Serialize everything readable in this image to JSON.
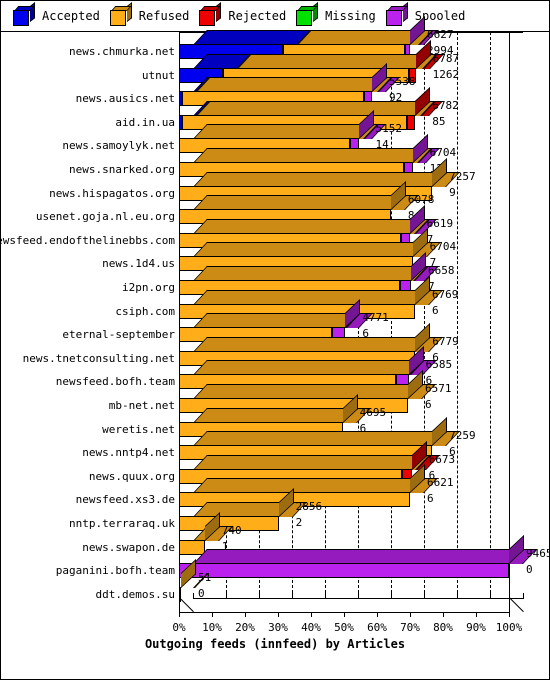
{
  "legend": {
    "items": [
      {
        "label": "Accepted",
        "color": "#0000ee",
        "icon": "cube-icon"
      },
      {
        "label": "Refused",
        "color": "#ffae1a",
        "icon": "cube-icon"
      },
      {
        "label": "Rejected",
        "color": "#ee0000",
        "icon": "cube-icon"
      },
      {
        "label": "Missing",
        "color": "#00e000",
        "icon": "cube-icon"
      },
      {
        "label": "Spooled",
        "color": "#bb22ee",
        "icon": "cube-icon"
      }
    ]
  },
  "chart_data": {
    "type": "bar",
    "orientation": "horizontal",
    "stacked": true,
    "title": "Outgoing feeds (innfeed) by Articles",
    "xlabel": "Outgoing feeds (innfeed) by Articles",
    "ylabel": "",
    "grid": true,
    "legend_position": "top",
    "xlim": [
      0,
      100
    ],
    "xunit": "%",
    "xticks": [
      0,
      10,
      20,
      30,
      40,
      50,
      60,
      70,
      80,
      90,
      100
    ],
    "xticklabels": [
      "0%",
      "10%",
      "20%",
      "30%",
      "40%",
      "50%",
      "60%",
      "70%",
      "80%",
      "90%",
      "100%"
    ],
    "series_names": [
      "Accepted",
      "Refused",
      "Rejected",
      "Missing",
      "Spooled"
    ],
    "categories": [
      "news.chmurka.net",
      "utnut",
      "news.ausics.net",
      "aid.in.ua",
      "news.samoylyk.net",
      "news.snarked.org",
      "news.hispagatos.org",
      "usenet.goja.nl.eu.org",
      "newsfeed.endofthelinebbs.com",
      "news.1d4.us",
      "i2pn.org",
      "csiph.com",
      "eternal-september",
      "news.tnetconsulting.net",
      "newsfeed.bofh.team",
      "mb-net.net",
      "weretis.net",
      "news.nntp4.net",
      "news.quux.org",
      "newsfeed.xs3.de",
      "nntp.terraraq.uk",
      "news.swapon.de",
      "paganini.bofh.team",
      "ddt.demos.su"
    ],
    "rows": [
      {
        "category": "news.chmurka.net",
        "total_label": "6627",
        "sub_label": "2994",
        "total_pct": 70.0,
        "segments": [
          {
            "name": "Accepted",
            "pct": 31.5
          },
          {
            "name": "Refused",
            "pct": 37.0
          },
          {
            "name": "Spooled",
            "pct": 1.5
          }
        ]
      },
      {
        "category": "utnut",
        "total_label": "6787",
        "sub_label": "1262",
        "total_pct": 71.7,
        "segments": [
          {
            "name": "Accepted",
            "pct": 13.3
          },
          {
            "name": "Refused",
            "pct": 56.4
          },
          {
            "name": "Rejected",
            "pct": 2.0
          }
        ]
      },
      {
        "category": "news.ausics.net",
        "total_label": "5538",
        "sub_label": "92",
        "total_pct": 58.5,
        "segments": [
          {
            "name": "Accepted",
            "pct": 1.0
          },
          {
            "name": "Refused",
            "pct": 55.0
          },
          {
            "name": "Spooled",
            "pct": 2.5
          }
        ]
      },
      {
        "category": "aid.in.ua",
        "total_label": "6782",
        "sub_label": "85",
        "total_pct": 71.6,
        "segments": [
          {
            "name": "Accepted",
            "pct": 0.9
          },
          {
            "name": "Refused",
            "pct": 68.2
          },
          {
            "name": "Rejected",
            "pct": 2.5
          }
        ]
      },
      {
        "category": "news.samoylyk.net",
        "total_label": "5152",
        "sub_label": "14",
        "total_pct": 54.4,
        "segments": [
          {
            "name": "Refused",
            "pct": 51.9
          },
          {
            "name": "Spooled",
            "pct": 2.5
          }
        ]
      },
      {
        "category": "news.snarked.org",
        "total_label": "6704",
        "sub_label": "12",
        "total_pct": 70.8,
        "segments": [
          {
            "name": "Refused",
            "pct": 68.3
          },
          {
            "name": "Spooled",
            "pct": 2.5
          }
        ]
      },
      {
        "category": "news.hispagatos.org",
        "total_label": "7257",
        "sub_label": "9",
        "total_pct": 76.7,
        "segments": [
          {
            "name": "Refused",
            "pct": 76.7
          }
        ]
      },
      {
        "category": "usenet.goja.nl.eu.org",
        "total_label": "6078",
        "sub_label": "8",
        "total_pct": 64.2,
        "segments": [
          {
            "name": "Refused",
            "pct": 64.2
          }
        ]
      },
      {
        "category": "newsfeed.endofthelinebbs.com",
        "total_label": "6619",
        "sub_label": "7",
        "total_pct": 69.9,
        "segments": [
          {
            "name": "Refused",
            "pct": 67.4
          },
          {
            "name": "Spooled",
            "pct": 2.5
          }
        ]
      },
      {
        "category": "news.1d4.us",
        "total_label": "6704",
        "sub_label": "7",
        "total_pct": 70.8,
        "segments": [
          {
            "name": "Refused",
            "pct": 70.8
          }
        ]
      },
      {
        "category": "i2pn.org",
        "total_label": "6658",
        "sub_label": "7",
        "total_pct": 70.3,
        "segments": [
          {
            "name": "Refused",
            "pct": 67.0
          },
          {
            "name": "Spooled",
            "pct": 3.3
          }
        ]
      },
      {
        "category": "csiph.com",
        "total_label": "6769",
        "sub_label": "6",
        "total_pct": 71.5,
        "segments": [
          {
            "name": "Refused",
            "pct": 71.5
          }
        ]
      },
      {
        "category": "eternal-september",
        "total_label": "4771",
        "sub_label": "6",
        "total_pct": 50.4,
        "segments": [
          {
            "name": "Refused",
            "pct": 46.5
          },
          {
            "name": "Spooled",
            "pct": 3.9
          }
        ]
      },
      {
        "category": "news.tnetconsulting.net",
        "total_label": "6779",
        "sub_label": "6",
        "total_pct": 71.6,
        "segments": [
          {
            "name": "Refused",
            "pct": 71.6
          }
        ]
      },
      {
        "category": "newsfeed.bofh.team",
        "total_label": "6585",
        "sub_label": "6",
        "total_pct": 69.6,
        "segments": [
          {
            "name": "Refused",
            "pct": 65.8
          },
          {
            "name": "Spooled",
            "pct": 3.8
          }
        ]
      },
      {
        "category": "mb-net.net",
        "total_label": "6571",
        "sub_label": "6",
        "total_pct": 69.4,
        "segments": [
          {
            "name": "Refused",
            "pct": 69.4
          }
        ]
      },
      {
        "category": "weretis.net",
        "total_label": "4695",
        "sub_label": "6",
        "total_pct": 49.6,
        "segments": [
          {
            "name": "Refused",
            "pct": 49.6
          }
        ]
      },
      {
        "category": "news.nntp4.net",
        "total_label": "7259",
        "sub_label": "6",
        "total_pct": 76.7,
        "segments": [
          {
            "name": "Refused",
            "pct": 76.7
          }
        ]
      },
      {
        "category": "news.quux.org",
        "total_label": "6673",
        "sub_label": "6",
        "total_pct": 70.5,
        "segments": [
          {
            "name": "Refused",
            "pct": 67.6
          },
          {
            "name": "Rejected",
            "pct": 2.9
          }
        ]
      },
      {
        "category": "newsfeed.xs3.de",
        "total_label": "6621",
        "sub_label": "6",
        "total_pct": 70.0,
        "segments": [
          {
            "name": "Refused",
            "pct": 70.0
          }
        ]
      },
      {
        "category": "nntp.terraraq.uk",
        "total_label": "2856",
        "sub_label": "2",
        "total_pct": 30.2,
        "segments": [
          {
            "name": "Refused",
            "pct": 30.2
          }
        ]
      },
      {
        "category": "news.swapon.de",
        "total_label": "740",
        "sub_label": "1",
        "total_pct": 7.8,
        "segments": [
          {
            "name": "Refused",
            "pct": 7.8
          }
        ]
      },
      {
        "category": "paganini.bofh.team",
        "total_label": "9465",
        "sub_label": "0",
        "total_pct": 100.0,
        "segments": [
          {
            "name": "Spooled",
            "pct": 100.0
          }
        ]
      },
      {
        "category": "ddt.demos.su",
        "total_label": "51",
        "sub_label": "0",
        "total_pct": 0.6,
        "segments": [
          {
            "name": "Refused",
            "pct": 0.6
          }
        ]
      }
    ]
  }
}
